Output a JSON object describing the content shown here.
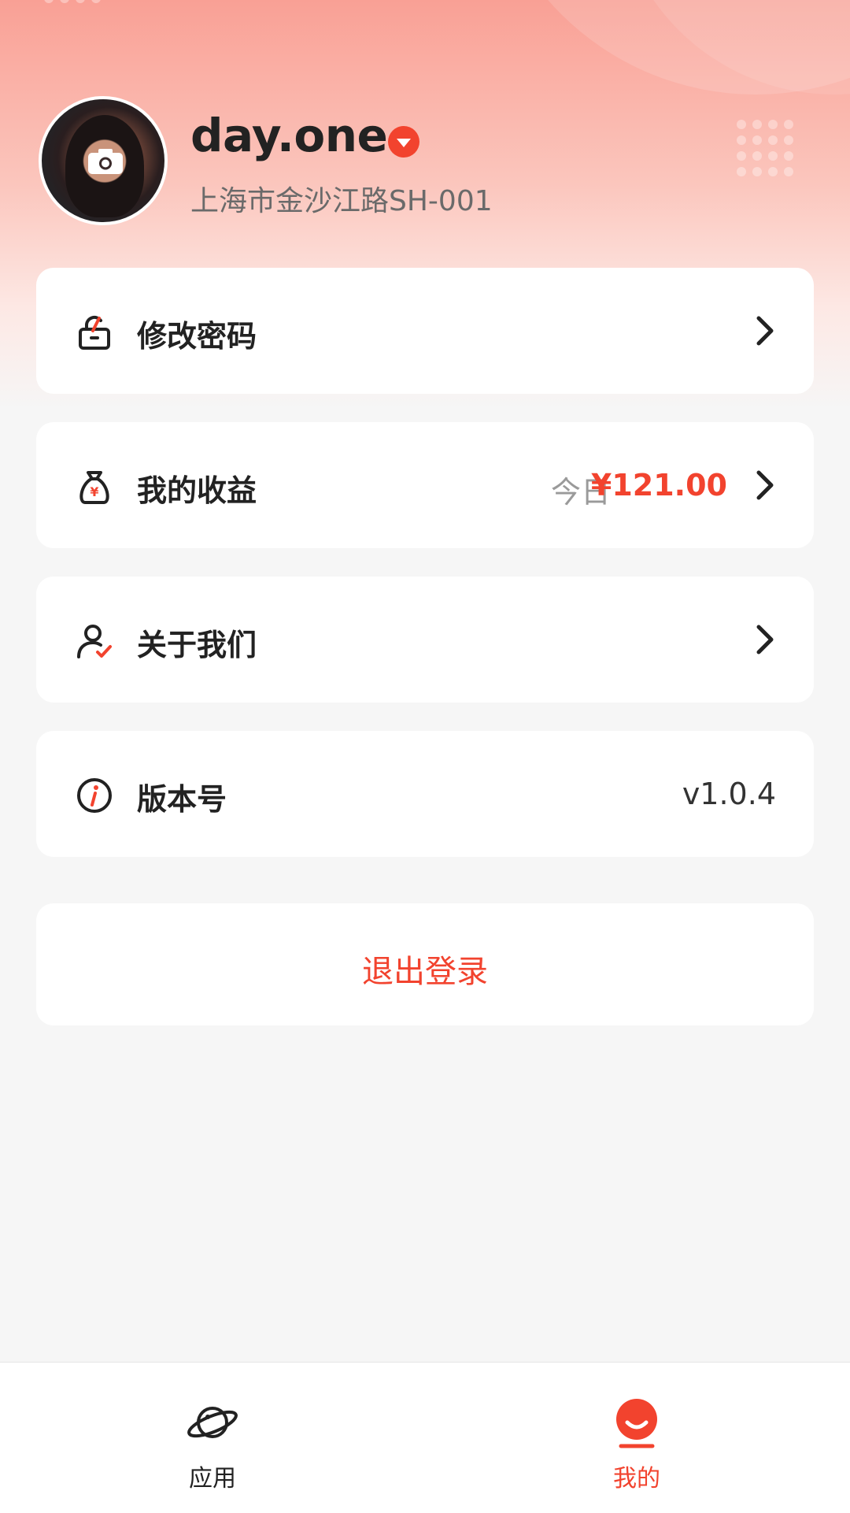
{
  "profile": {
    "name": "day.one",
    "address": "上海市金沙江路SH-001"
  },
  "menu": {
    "change_password": "修改密码",
    "earnings": {
      "label": "我的收益",
      "today_label": "今日",
      "today_amount": "¥121.00"
    },
    "about_us": "关于我们",
    "version": {
      "label": "版本号",
      "value": "v1.0.4"
    }
  },
  "logout_label": "退出登录",
  "tabbar": {
    "tabs": [
      {
        "label": "应用",
        "icon": "planet-icon",
        "active": false
      },
      {
        "label": "我的",
        "icon": "smile-face-icon",
        "active": true
      }
    ]
  },
  "colors": {
    "accent": "#f2432e",
    "background": "#f6f6f6",
    "header_gradient": "#f9a095"
  }
}
